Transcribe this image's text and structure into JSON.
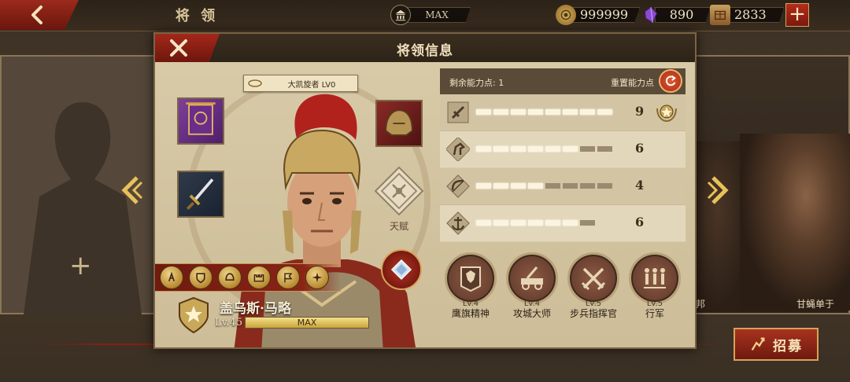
{
  "topbar": {
    "title": "将 领",
    "rank_label": "MAX",
    "resources": [
      {
        "icon": "coin-icon",
        "value": "999999",
        "color": "#b08a3a"
      },
      {
        "icon": "purple-gem-icon",
        "value": "890",
        "color": "#7b3fb4"
      },
      {
        "icon": "supply-crate-icon",
        "value": "2833",
        "color": "#a8463a"
      }
    ],
    "add_label": "+"
  },
  "background": {
    "empty_slot_plus": "+",
    "right_hero_name": "甘蝇单于",
    "right_hero_name2": "邦"
  },
  "recruit": {
    "label": "招募"
  },
  "modal": {
    "title": "将领信息",
    "level_tag": "大凯旋者 LV0",
    "talent_label": "天赋",
    "hero": {
      "name": "盖乌斯·马略",
      "level": "Lv.45",
      "xp_label": "MAX",
      "xp_fraction": 1.0
    },
    "skills": [
      "infantry-skill-icon",
      "shield-skill-icon",
      "helmet-skill-icon",
      "fort-skill-icon",
      "banner-skill-icon",
      "compass-skill-icon"
    ]
  },
  "stats": {
    "remaining_label": "剩余能力点: 1",
    "reset_label": "重置能力点",
    "rows": [
      {
        "icon": "sword-icon",
        "value": "9",
        "filled": 8,
        "total": 8
      },
      {
        "icon": "horse-icon",
        "value": "6",
        "filled": 6,
        "total": 8
      },
      {
        "icon": "bow-icon",
        "value": "4",
        "filled": 4,
        "total": 8
      },
      {
        "icon": "anchor-icon",
        "value": "6",
        "filled": 6,
        "total": 7
      }
    ]
  },
  "traits": [
    {
      "icon": "eagle-banner-icon",
      "level": "Lv.4",
      "name": "鹰旗精神"
    },
    {
      "icon": "siege-engine-icon",
      "level": "Lv.4",
      "name": "攻城大师"
    },
    {
      "icon": "crossed-swords-icon",
      "level": "Lv.5",
      "name": "步兵指挥官"
    },
    {
      "icon": "marching-soldiers-icon",
      "level": "Lv.5",
      "name": "行军"
    }
  ],
  "colors": {
    "accent_red": "#8a2416",
    "gold": "#d6a25a",
    "parchment": "#d9cba9"
  }
}
